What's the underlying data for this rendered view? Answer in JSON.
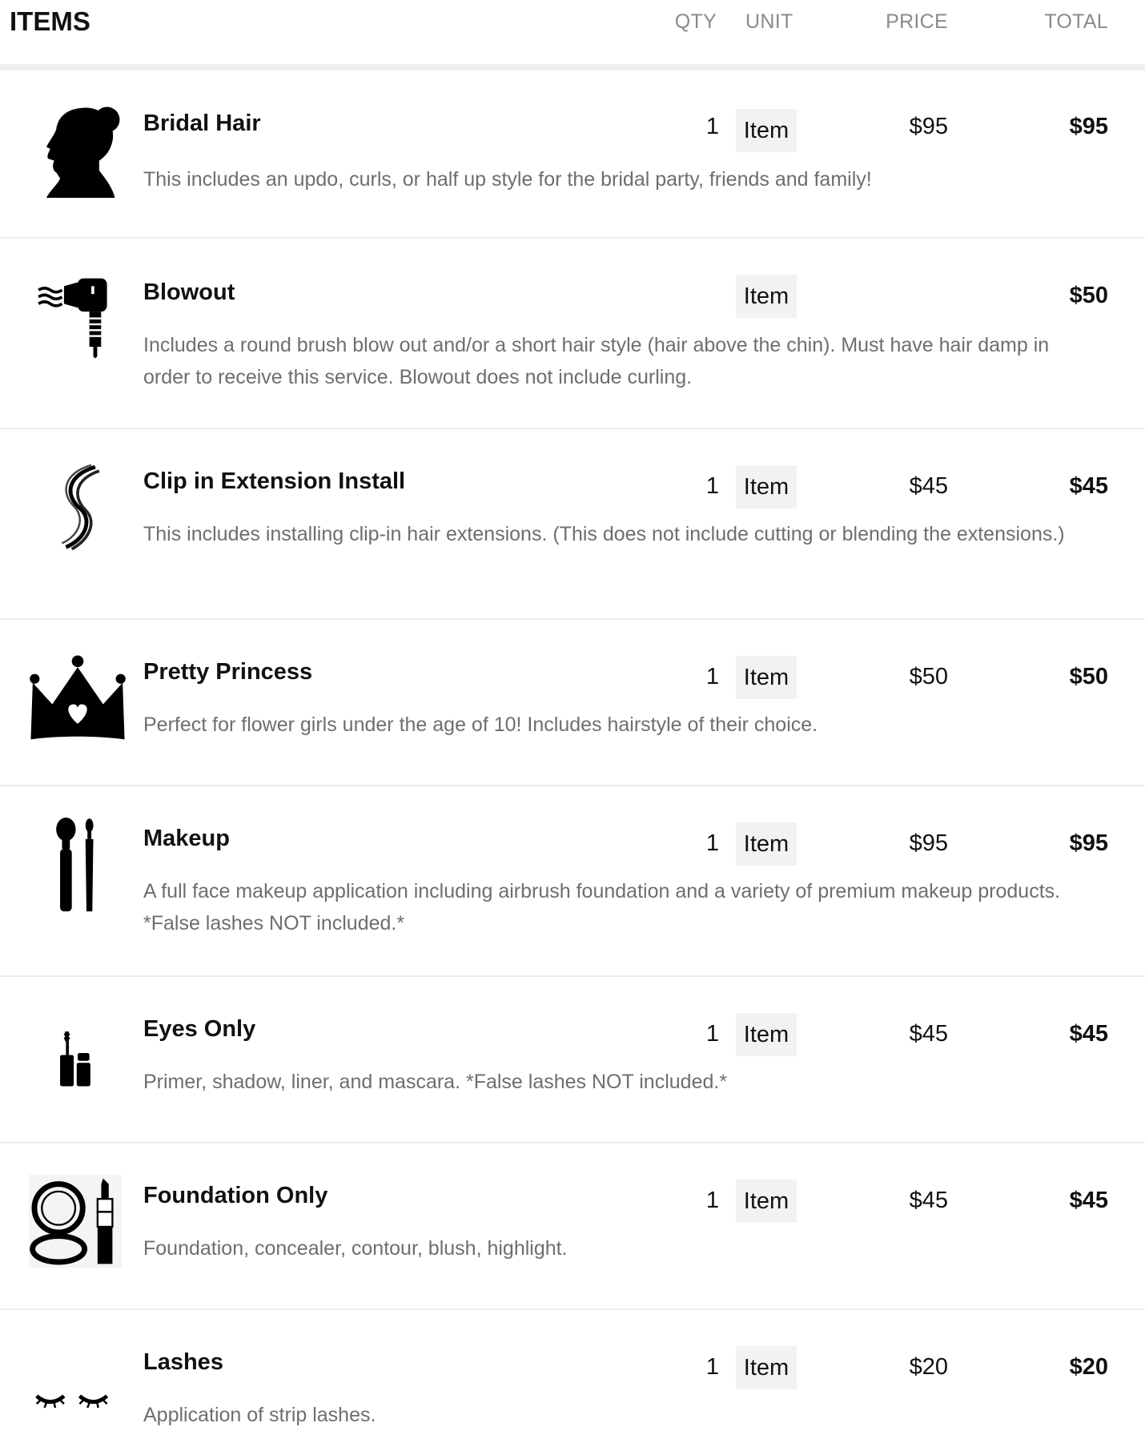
{
  "header": {
    "items": "ITEMS",
    "qty": "QTY",
    "unit": "UNIT",
    "price": "PRICE",
    "total": "TOTAL"
  },
  "items": [
    {
      "name": "Bridal Hair",
      "qty": "1",
      "unit": "Item",
      "price": "$95",
      "total": "$95",
      "icon": "woman-silhouette-icon",
      "desc": "This includes an updo, curls, or half up style for the bridal party, friends and family!"
    },
    {
      "name": "Blowout",
      "qty": "",
      "unit": "Item",
      "price": "",
      "total": "$50",
      "icon": "hair-dryer-icon",
      "desc": "Includes a round brush blow out and/or a short hair style (hair above the chin). Must have hair damp in order to receive this service. Blowout does not include curling."
    },
    {
      "name": "Clip in Extension Install",
      "qty": "1",
      "unit": "Item",
      "price": "$45",
      "total": "$45",
      "icon": "hair-strand-icon",
      "desc": "This includes installing clip-in hair extensions. (This does not include cutting or blending the extensions.)"
    },
    {
      "name": "Pretty Princess",
      "qty": "1",
      "unit": "Item",
      "price": "$50",
      "total": "$50",
      "icon": "crown-icon",
      "desc": "Perfect for flower girls under the age of 10! Includes hairstyle of their choice."
    },
    {
      "name": "Makeup",
      "qty": "1",
      "unit": "Item",
      "price": "$95",
      "total": "$95",
      "icon": "makeup-brushes-icon",
      "desc": "A full face makeup application including airbrush foundation and a variety of premium makeup products. *False lashes NOT included.*"
    },
    {
      "name": "Eyes Only",
      "qty": "1",
      "unit": "Item",
      "price": "$45",
      "total": "$45",
      "icon": "mascara-icon",
      "desc": "Primer, shadow, liner, and mascara. *False lashes NOT included.*"
    },
    {
      "name": "Foundation Only",
      "qty": "1",
      "unit": "Item",
      "price": "$45",
      "total": "$45",
      "icon": "compact-lipstick-icon",
      "desc": "Foundation, concealer, contour, blush, highlight."
    },
    {
      "name": "Lashes",
      "qty": "1",
      "unit": "Item",
      "price": "$20",
      "total": "$20",
      "icon": "eyelashes-icon",
      "desc": "Application of strip lashes."
    }
  ]
}
